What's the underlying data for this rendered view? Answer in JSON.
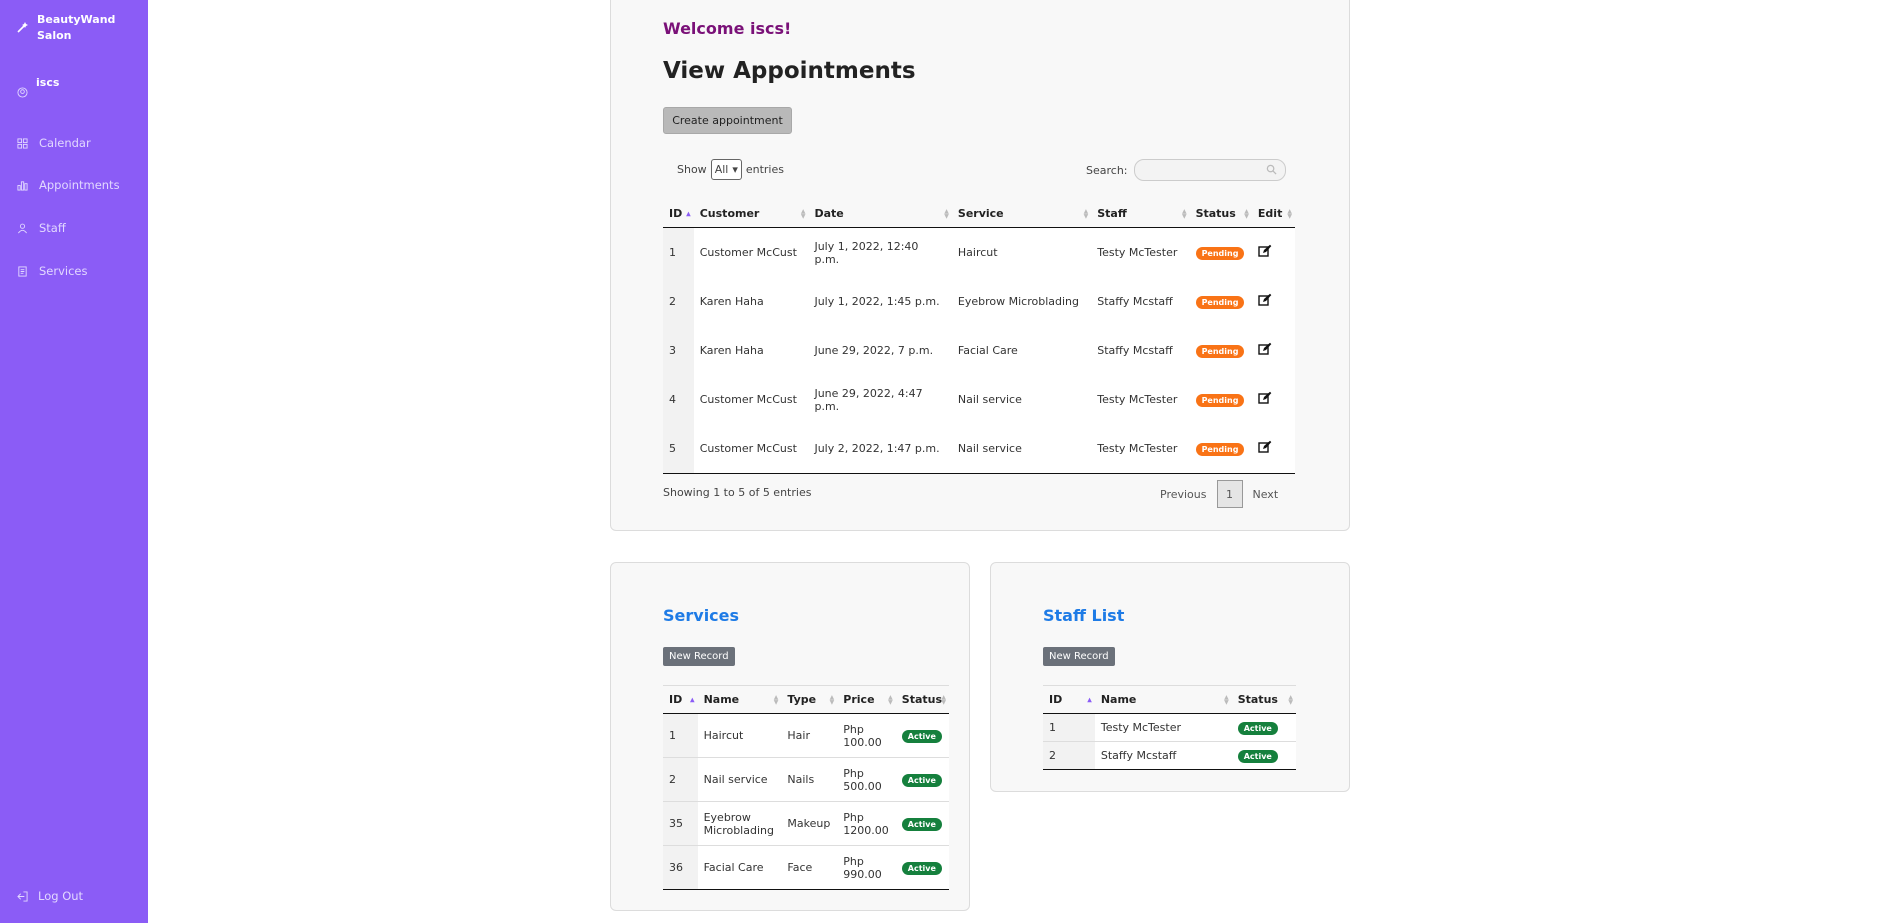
{
  "sidebar": {
    "brand": "BeautyWand Salon",
    "user": "iscs",
    "items": [
      {
        "label": "Calendar",
        "icon": "grid-icon"
      },
      {
        "label": "Appointments",
        "icon": "bar-chart-icon"
      },
      {
        "label": "Staff",
        "icon": "person-icon"
      },
      {
        "label": "Services",
        "icon": "document-icon"
      }
    ],
    "logout": "Log Out"
  },
  "appointments": {
    "welcome": "Welcome iscs!",
    "title": "View Appointments",
    "create_button": "Create appointment",
    "show_label": "Show",
    "show_value": "All",
    "entries_label": "entries",
    "search_label": "Search:",
    "search_value": "",
    "columns": [
      "ID",
      "Customer",
      "Date",
      "Service",
      "Staff",
      "Status",
      "Edit"
    ],
    "rows": [
      {
        "id": "1",
        "customer": "Customer McCust",
        "date": "July 1, 2022, 12:40 p.m.",
        "service": "Haircut",
        "staff": "Testy McTester",
        "status": "Pending"
      },
      {
        "id": "2",
        "customer": "Karen Haha",
        "date": "July 1, 2022, 1:45 p.m.",
        "service": "Eyebrow Microblading",
        "staff": "Staffy Mcstaff",
        "status": "Pending"
      },
      {
        "id": "3",
        "customer": "Karen Haha",
        "date": "June 29, 2022, 7 p.m.",
        "service": "Facial Care",
        "staff": "Staffy Mcstaff",
        "status": "Pending"
      },
      {
        "id": "4",
        "customer": "Customer McCust",
        "date": "June 29, 2022, 4:47 p.m.",
        "service": "Nail service",
        "staff": "Testy McTester",
        "status": "Pending"
      },
      {
        "id": "5",
        "customer": "Customer McCust",
        "date": "July 2, 2022, 1:47 p.m.",
        "service": "Nail service",
        "staff": "Testy McTester",
        "status": "Pending"
      }
    ],
    "showing": "Showing 1 to 5 of 5 entries",
    "pager": {
      "previous": "Previous",
      "page": "1",
      "next": "Next"
    }
  },
  "services": {
    "title": "Services",
    "new_button": "New Record",
    "columns": [
      "ID",
      "Name",
      "Type",
      "Price",
      "Status"
    ],
    "rows": [
      {
        "id": "1",
        "name": "Haircut",
        "type": "Hair",
        "price": "Php 100.00",
        "status": "Active"
      },
      {
        "id": "2",
        "name": "Nail service",
        "type": "Nails",
        "price": "Php 500.00",
        "status": "Active"
      },
      {
        "id": "35",
        "name": "Eyebrow Microblading",
        "type": "Makeup",
        "price": "Php 1200.00",
        "status": "Active"
      },
      {
        "id": "36",
        "name": "Facial Care",
        "type": "Face",
        "price": "Php 990.00",
        "status": "Active"
      }
    ]
  },
  "staff": {
    "title": "Staff List",
    "new_button": "New Record",
    "columns": [
      "ID",
      "Name",
      "Status"
    ],
    "rows": [
      {
        "id": "1",
        "name": "Testy McTester",
        "status": "Active"
      },
      {
        "id": "2",
        "name": "Staffy Mcstaff",
        "status": "Active"
      }
    ]
  },
  "colors": {
    "sidebar": "#8b5cf6",
    "pending": "#f97316",
    "active": "#15803d",
    "link": "#6f5bd8",
    "section_title": "#1e7be6",
    "welcome": "#7a1178"
  }
}
